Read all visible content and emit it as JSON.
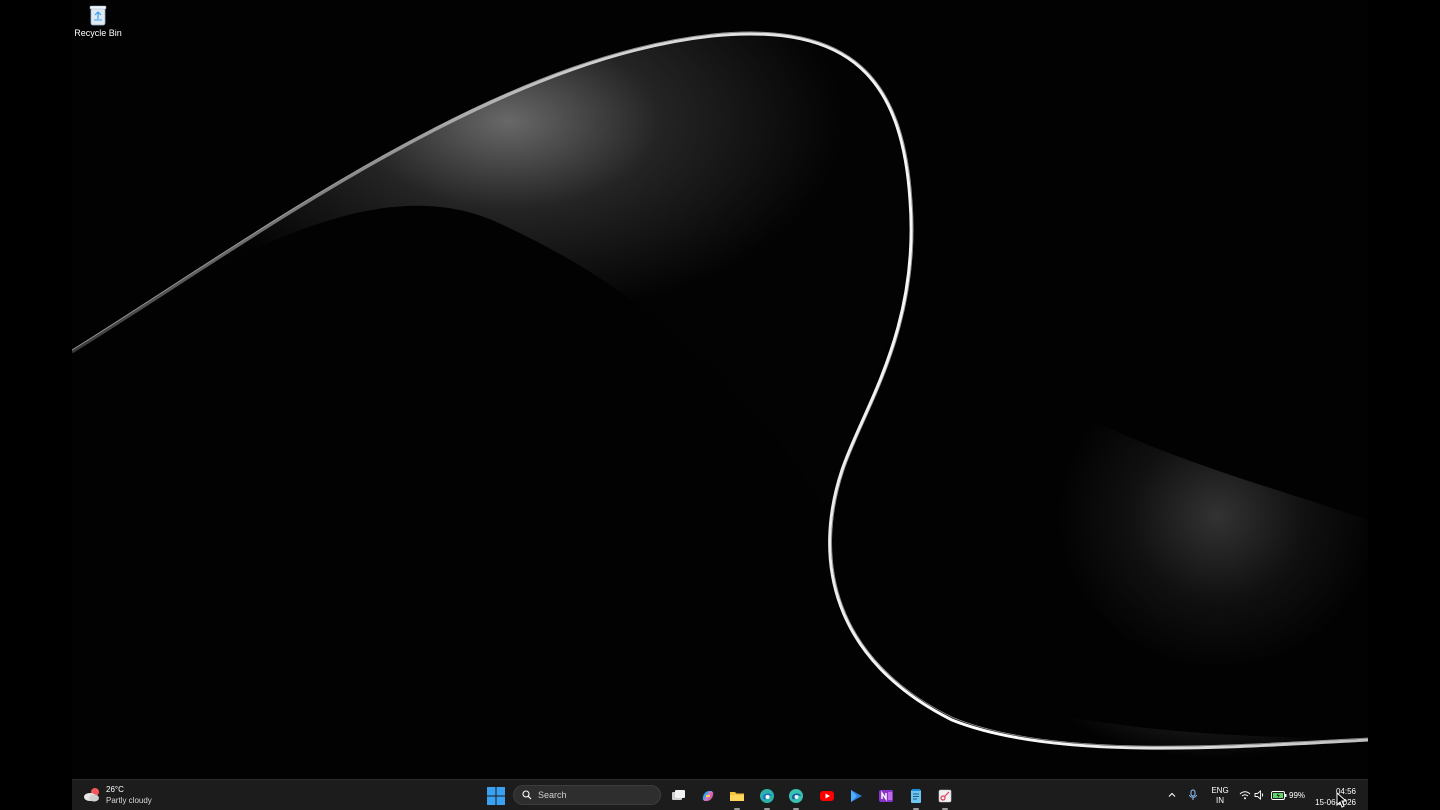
{
  "desktop": {
    "icons": [
      {
        "label": "Recycle Bin",
        "icon": "recycle-bin-icon"
      }
    ]
  },
  "taskbar": {
    "weather": {
      "temperature": "26°C",
      "condition": "Partly cloudy",
      "icon": "partly-cloudy-icon"
    },
    "search": {
      "placeholder": "Search"
    },
    "pinned_apps": [
      {
        "name": "task-view",
        "icon": "task-view-icon",
        "running": false
      },
      {
        "name": "copilot",
        "icon": "copilot-icon",
        "running": false
      },
      {
        "name": "file-explorer",
        "icon": "folder-icon",
        "running": true
      },
      {
        "name": "edge",
        "icon": "edge-icon",
        "running": true
      },
      {
        "name": "edge-dev",
        "icon": "edge-dev-icon",
        "running": true
      },
      {
        "name": "youtube",
        "icon": "youtube-icon",
        "running": false
      },
      {
        "name": "play-store",
        "icon": "play-icon",
        "running": false
      },
      {
        "name": "onenote",
        "icon": "onenote-icon",
        "running": false
      },
      {
        "name": "notepad",
        "icon": "notepad-icon",
        "running": true
      },
      {
        "name": "snipping-tool",
        "icon": "snipping-tool-icon",
        "running": true
      }
    ],
    "tray": {
      "language": {
        "line1": "ENG",
        "line2": "IN"
      },
      "battery": "99%",
      "time": "04:56",
      "date": "15-06-2026"
    }
  },
  "colors": {
    "taskbar_bg": "#1c1c1c",
    "accent_blue": "#3aa0f0"
  }
}
